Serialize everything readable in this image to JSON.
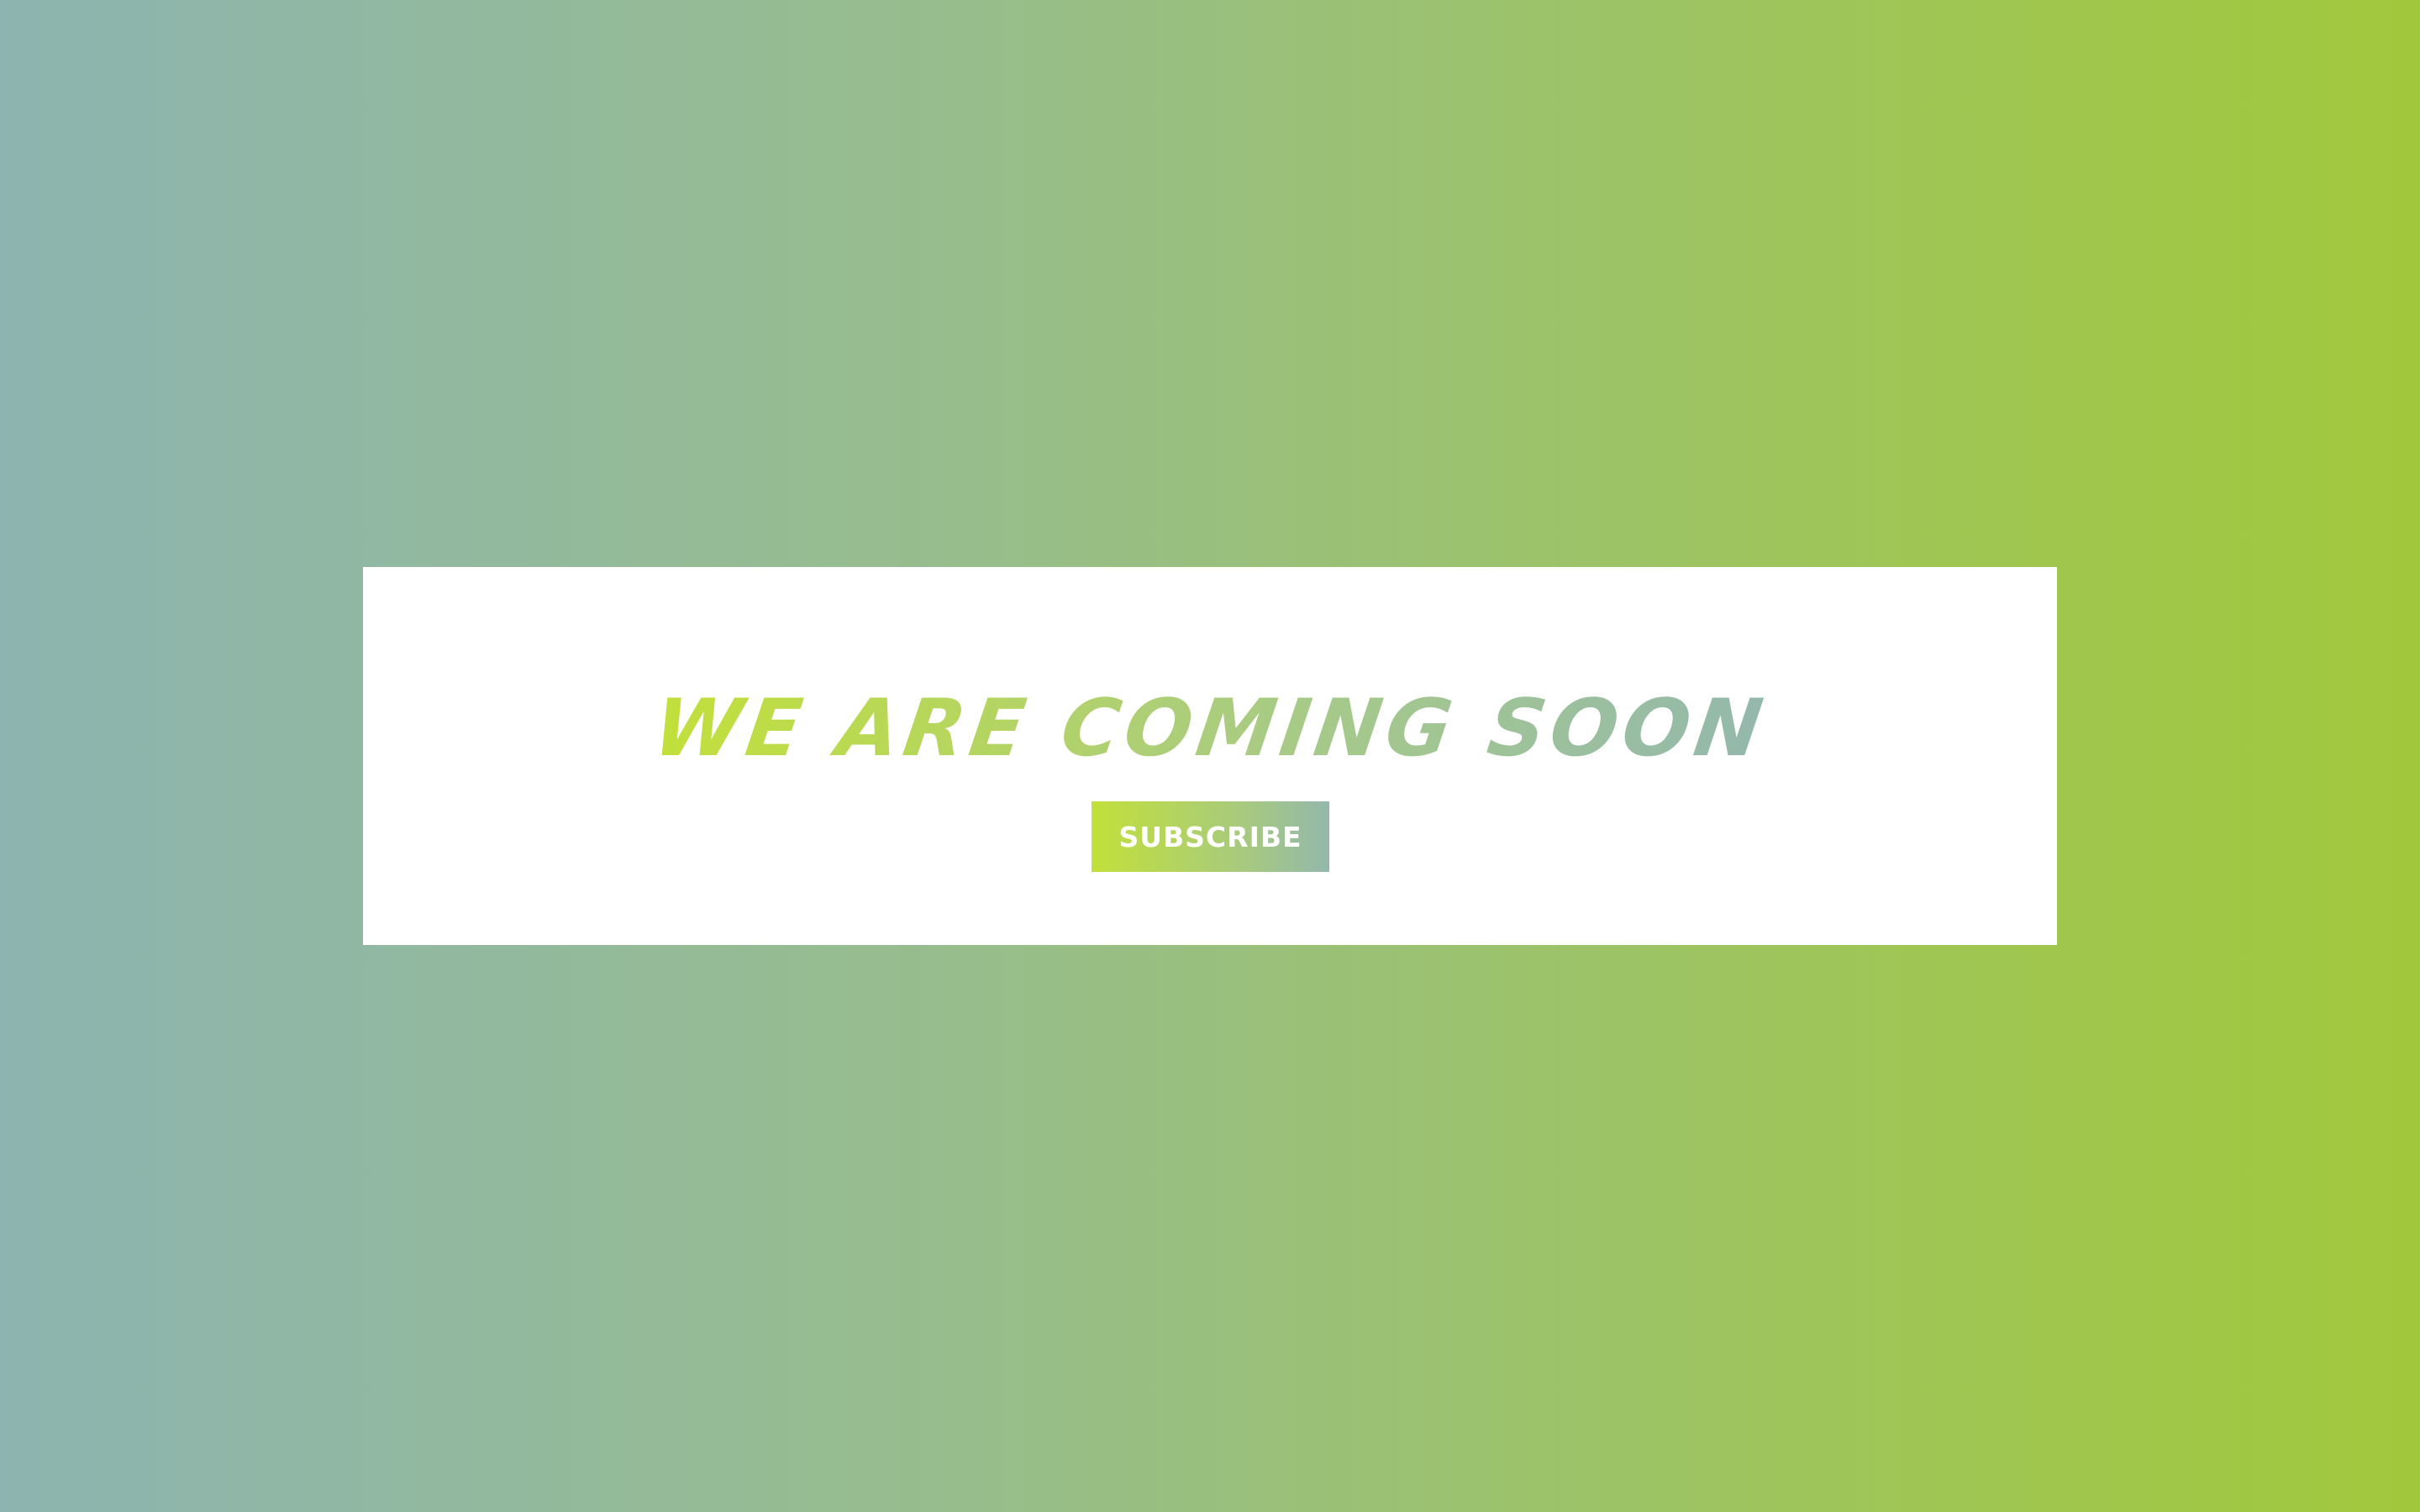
{
  "hero": {
    "headline": "WE ARE COMING SOON",
    "subscribe_label": "SUBSCRIBE"
  },
  "colors": {
    "background_left": "#8db4b0",
    "background_right": "#a1c83c",
    "accent_lime": "#c2e03a",
    "accent_sage": "#93b8ac",
    "card": "#ffffff"
  }
}
